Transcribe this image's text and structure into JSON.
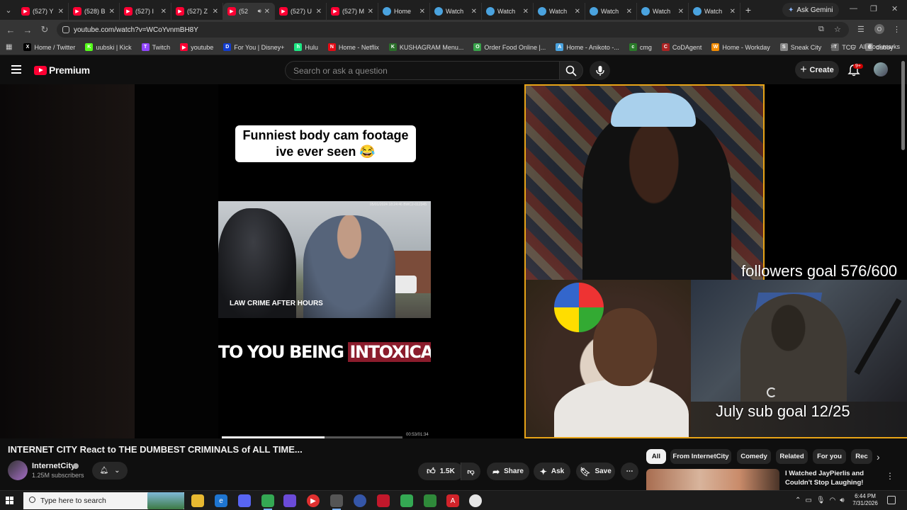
{
  "browser": {
    "tabs": [
      {
        "label": "(527) Y",
        "icon": "youtube-icon",
        "active": false
      },
      {
        "label": "(528) B",
        "icon": "youtube-icon",
        "active": false
      },
      {
        "label": "(527) I",
        "icon": "youtube-icon",
        "active": false
      },
      {
        "label": "(527) Z",
        "icon": "youtube-icon",
        "active": false
      },
      {
        "label": "(52",
        "icon": "youtube-icon",
        "active": true
      },
      {
        "label": "(527) U",
        "icon": "youtube-icon",
        "active": false
      },
      {
        "label": "(527) M",
        "icon": "youtube-icon",
        "active": false
      },
      {
        "label": "Home",
        "icon": "globe-icon",
        "active": false
      },
      {
        "label": "Watch",
        "icon": "globe-icon",
        "active": false
      },
      {
        "label": "Watch",
        "icon": "globe-icon",
        "active": false
      },
      {
        "label": "Watch",
        "icon": "globe-icon",
        "active": false
      },
      {
        "label": "Watch",
        "icon": "globe-icon",
        "active": false
      },
      {
        "label": "Watch",
        "icon": "globe-icon",
        "active": false
      },
      {
        "label": "Watch",
        "icon": "globe-icon",
        "active": false
      }
    ],
    "gemini_label": "Ask Gemini",
    "url": "youtube.com/watch?v=WCoYvnmBH8Y",
    "profile_initial": "O",
    "bookmarks": [
      {
        "label": "Home / Twitter",
        "color": "#000000",
        "glyph": "X"
      },
      {
        "label": "uubski | Kick",
        "color": "#53fc18",
        "glyph": "K"
      },
      {
        "label": "Twitch",
        "color": "#9146ff",
        "glyph": "T"
      },
      {
        "label": "youtube",
        "color": "#ff0033",
        "glyph": "▶"
      },
      {
        "label": "For You | Disney+",
        "color": "#113ccf",
        "glyph": "D"
      },
      {
        "label": "Hulu",
        "color": "#1ce783",
        "glyph": "h"
      },
      {
        "label": "Home - Netflix",
        "color": "#e50914",
        "glyph": "N"
      },
      {
        "label": "KUSHAGRAM Menu...",
        "color": "#2a6e2a",
        "glyph": "K"
      },
      {
        "label": "Order Food Online |...",
        "color": "#38a24a",
        "glyph": "O"
      },
      {
        "label": "Home - Anikoto -...",
        "color": "#4aa3df",
        "glyph": "A"
      },
      {
        "label": "cmg",
        "color": "#2a7a2a",
        "glyph": "c"
      },
      {
        "label": "CoDAgent",
        "color": "#aa2222",
        "glyph": "C"
      },
      {
        "label": "Home - Workday",
        "color": "#f38b00",
        "glyph": "W"
      },
      {
        "label": "Sneak City",
        "color": "#888888",
        "glyph": "S"
      },
      {
        "label": "TCG",
        "color": "#666666",
        "glyph": "T"
      },
      {
        "label": "dubby",
        "color": "#777777",
        "glyph": "d"
      }
    ],
    "all_bookmarks_label": "All Bookmarks"
  },
  "youtube": {
    "logo_text": "Premium",
    "search_placeholder": "Search or ask a question",
    "create_label": "Create",
    "notification_count": "9+"
  },
  "player": {
    "caption": "Funniest body cam footage ive ever seen 😂",
    "bodycam_stamp": "05/01/2024 18:24:46 BWC2-012345",
    "law_crime_logo": "LAW CRIME AFTER HOURS",
    "subtitle_prefix": "TO YOU BEING ",
    "subtitle_highlight": "INTOXICATED",
    "followers_goal": "followers goal 576/600",
    "sub_goal": "July sub goal 12/25",
    "timecode": "00:53/01:34",
    "progress": 0.57
  },
  "video": {
    "title": "INTERNET CITY React to THE DUMBEST CRIMINALS of ALL TIME...",
    "channel": "InternetCity",
    "subscribers": "1.25M subscribers",
    "likes": "1.5K",
    "share_label": "Share",
    "ask_label": "Ask",
    "save_label": "Save"
  },
  "chips": [
    "All",
    "From InternetCity",
    "Comedy",
    "Related",
    "For you",
    "Rec"
  ],
  "recommendation": {
    "title": "I Watched JayPierlis and Couldn't Stop Laughing!"
  },
  "taskbar": {
    "search_placeholder": "Type here to search",
    "time": "6:44 PM",
    "date": "7/31/2026"
  }
}
